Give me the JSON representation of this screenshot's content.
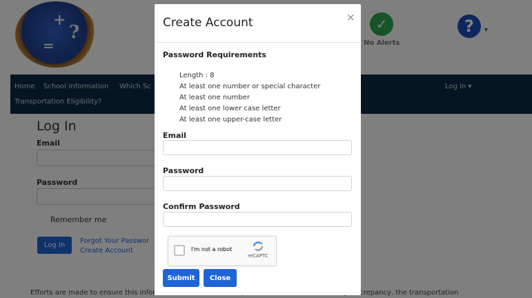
{
  "header": {
    "logo_symbols": [
      "+",
      "?",
      "="
    ],
    "alerts_label": "No Alerts",
    "help_glyph": "?"
  },
  "nav": {
    "items": [
      "Home",
      "School Information",
      "Which Sc",
      "Transportation Eligibility?"
    ],
    "login_menu": "Log In ▾"
  },
  "login_form": {
    "title": "Log In",
    "email_label": "Email",
    "password_label": "Password",
    "remember_label": "Remember me",
    "login_button": "Log In",
    "forgot_link": "Forgot Your Passwor",
    "create_link": "Create Account"
  },
  "footer": {
    "text": "Efforts are made to ensure this information is accurate and up-to-date. Should there be any discrepancy, the transportation"
  },
  "modal": {
    "title": "Create Account",
    "close_glyph": "×",
    "requirements_title": "Password Requirements",
    "requirements": [
      "Length : 8",
      "At least one number or special character",
      "At least one number",
      "At least one lower case letter",
      "At least one upper-case letter"
    ],
    "email_label": "Email",
    "email_value": "",
    "password_label": "Password",
    "password_value": "",
    "confirm_password_label": "Confirm Password",
    "confirm_password_value": "",
    "recaptcha_label": "I'm not a robot",
    "recaptcha_brand": "reCAPTC",
    "submit_button": "Submit",
    "close_button": "Close"
  },
  "colors": {
    "primary": "#1e64d6",
    "navbar": "#0a2b49",
    "alert_green": "#2fa84f",
    "help_blue": "#1d4fbf"
  },
  "icons": {
    "alerts": "check-circle-icon",
    "help": "question-circle-icon",
    "close": "close-icon",
    "recaptcha": "recaptcha-logo-icon"
  }
}
